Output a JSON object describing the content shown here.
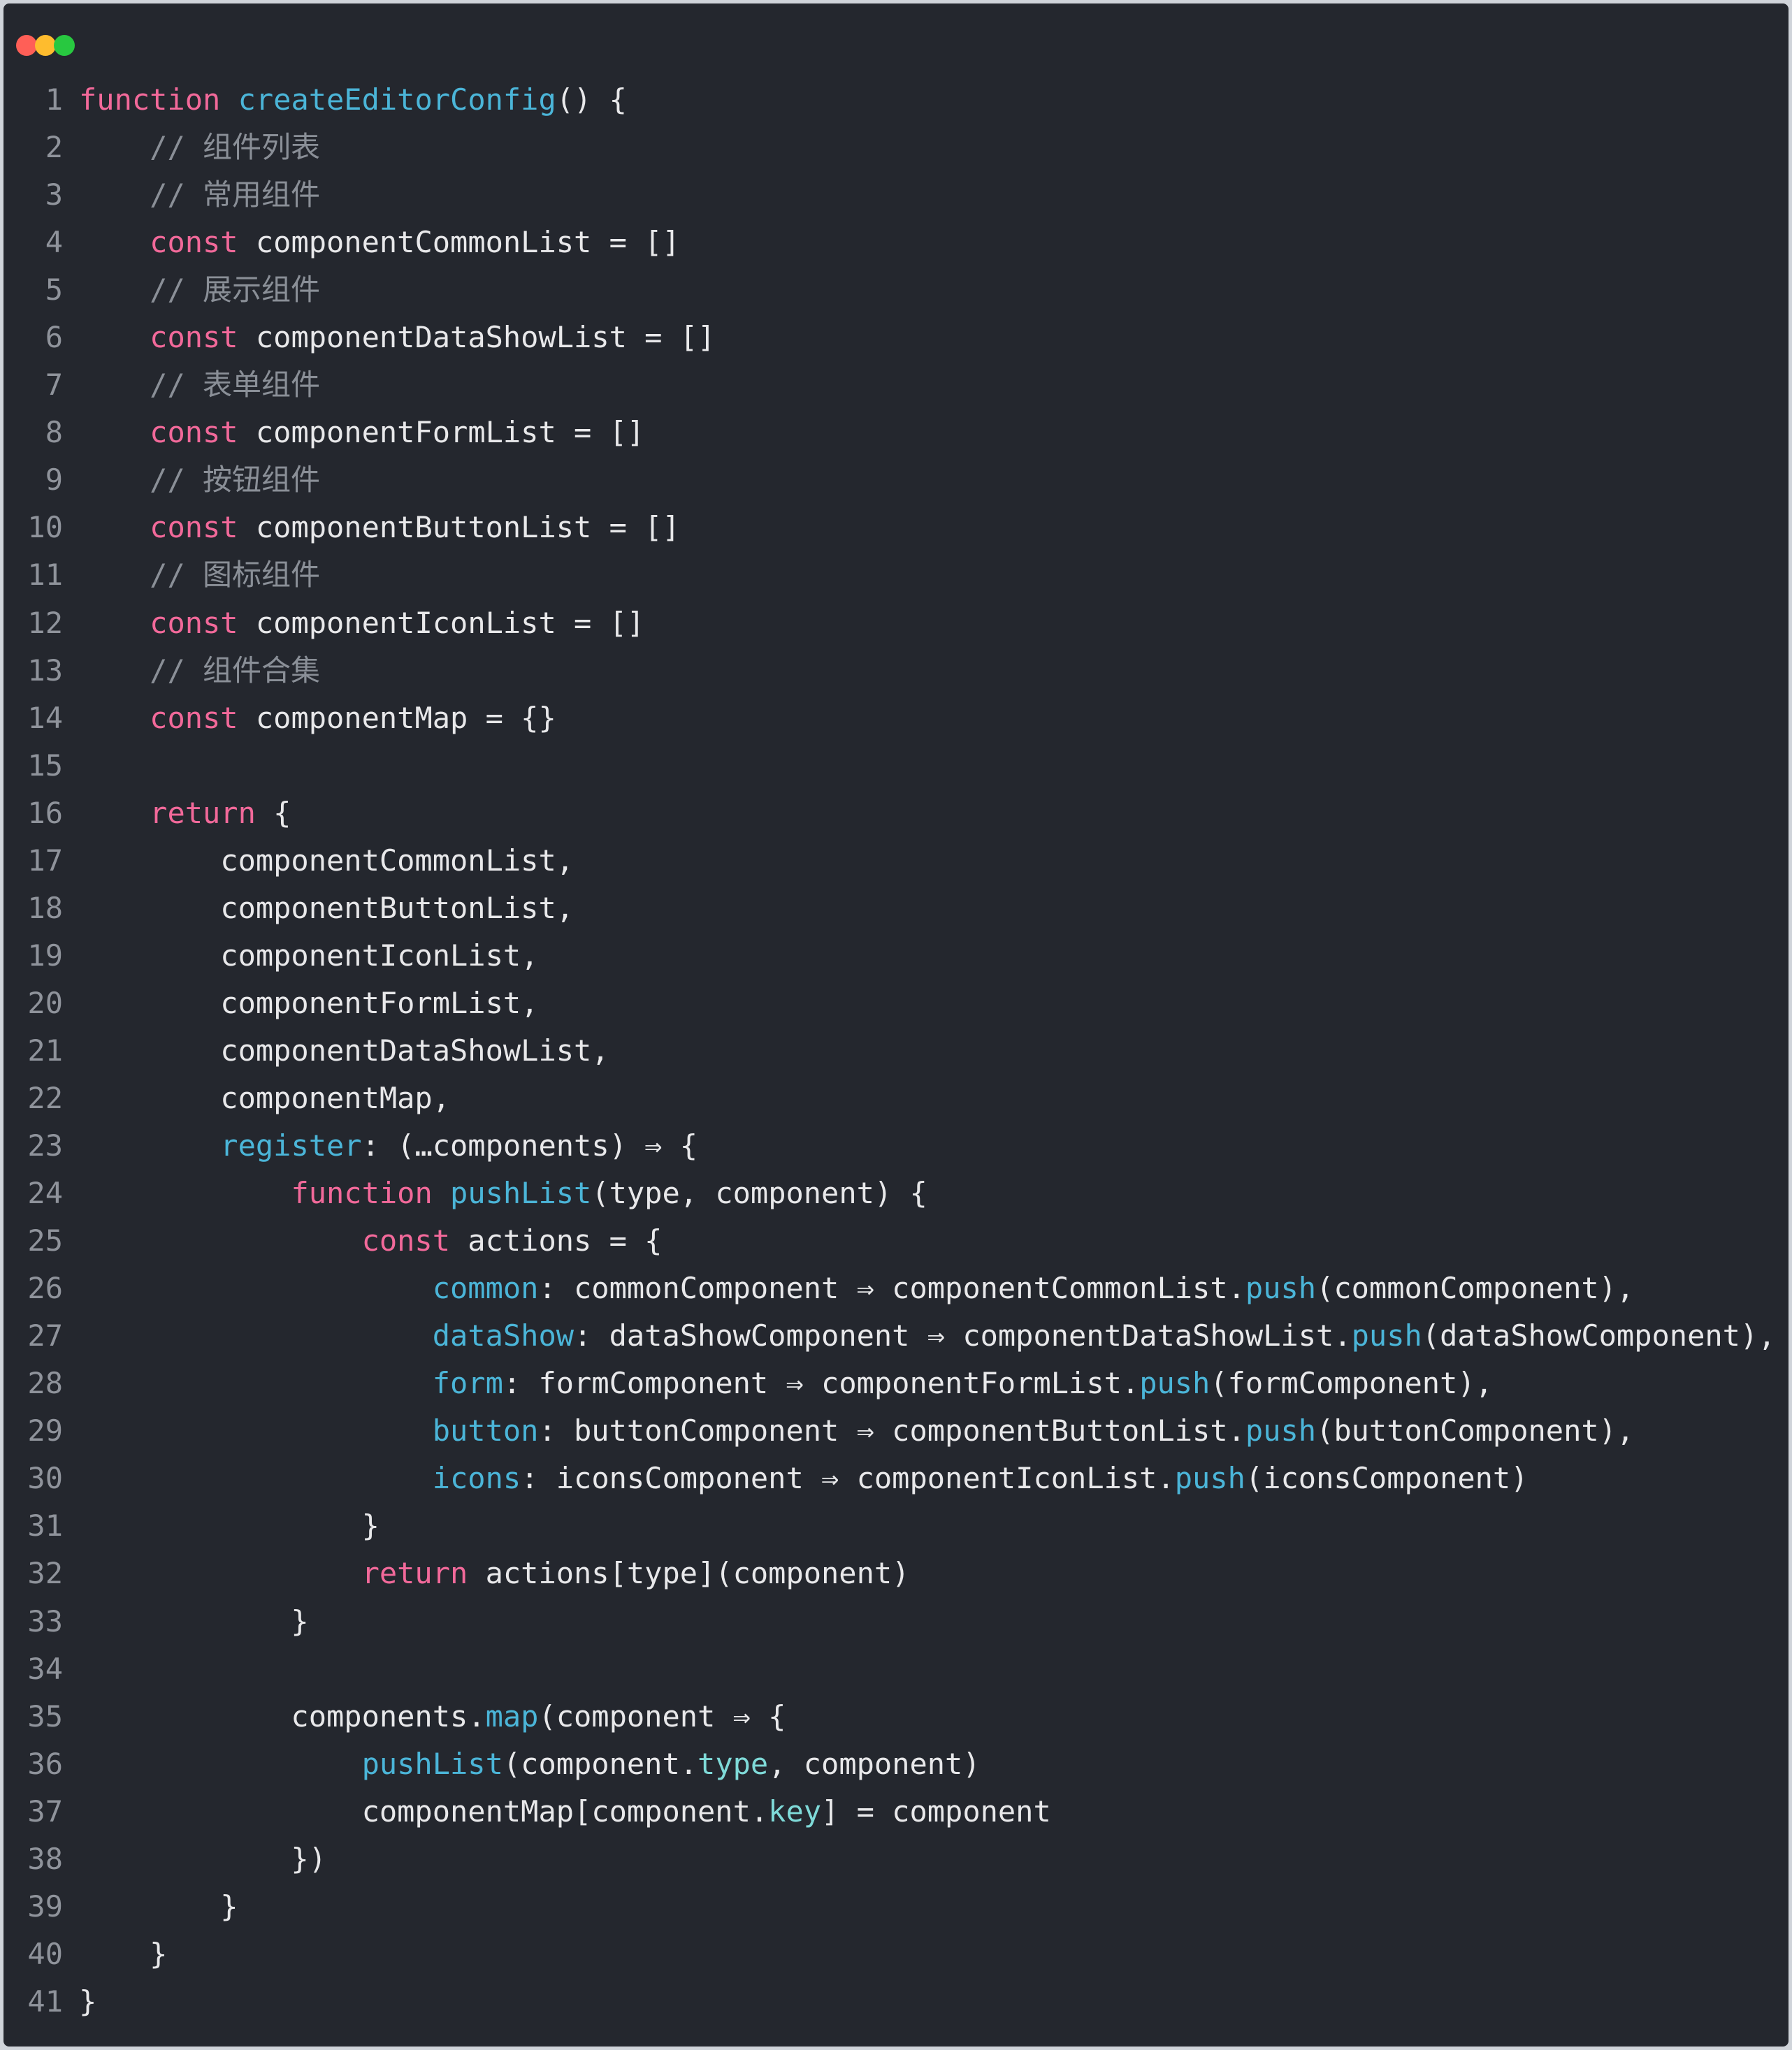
{
  "window": {
    "traffic_lights": [
      {
        "name": "close",
        "color": "#ff5f57"
      },
      {
        "name": "minimize",
        "color": "#febc2e"
      },
      {
        "name": "zoom",
        "color": "#28c840"
      }
    ]
  },
  "colors": {
    "background": "#24272e",
    "keyword": "#f2699a",
    "function": "#4bb5d8",
    "comment": "#8a8f97",
    "text": "#e8e8ea",
    "line_number": "#8f939b"
  },
  "code": {
    "language": "javascript",
    "lines": [
      {
        "n": "1",
        "tokens": [
          {
            "t": "k",
            "v": "function"
          },
          {
            "t": "p",
            "v": " "
          },
          {
            "t": "fn",
            "v": "createEditorConfig"
          },
          {
            "t": "p",
            "v": "() {"
          }
        ]
      },
      {
        "n": "2",
        "tokens": [
          {
            "t": "p",
            "v": "    "
          },
          {
            "t": "c",
            "v": "// 组件列表"
          }
        ]
      },
      {
        "n": "3",
        "tokens": [
          {
            "t": "p",
            "v": "    "
          },
          {
            "t": "c",
            "v": "// 常用组件"
          }
        ]
      },
      {
        "n": "4",
        "tokens": [
          {
            "t": "p",
            "v": "    "
          },
          {
            "t": "k",
            "v": "const"
          },
          {
            "t": "p",
            "v": " componentCommonList = []"
          }
        ]
      },
      {
        "n": "5",
        "tokens": [
          {
            "t": "p",
            "v": "    "
          },
          {
            "t": "c",
            "v": "// 展示组件"
          }
        ]
      },
      {
        "n": "6",
        "tokens": [
          {
            "t": "p",
            "v": "    "
          },
          {
            "t": "k",
            "v": "const"
          },
          {
            "t": "p",
            "v": " componentDataShowList = []"
          }
        ]
      },
      {
        "n": "7",
        "tokens": [
          {
            "t": "p",
            "v": "    "
          },
          {
            "t": "c",
            "v": "// 表单组件"
          }
        ]
      },
      {
        "n": "8",
        "tokens": [
          {
            "t": "p",
            "v": "    "
          },
          {
            "t": "k",
            "v": "const"
          },
          {
            "t": "p",
            "v": " componentFormList = []"
          }
        ]
      },
      {
        "n": "9",
        "tokens": [
          {
            "t": "p",
            "v": "    "
          },
          {
            "t": "c",
            "v": "// 按钮组件"
          }
        ]
      },
      {
        "n": "10",
        "tokens": [
          {
            "t": "p",
            "v": "    "
          },
          {
            "t": "k",
            "v": "const"
          },
          {
            "t": "p",
            "v": " componentButtonList = []"
          }
        ]
      },
      {
        "n": "11",
        "tokens": [
          {
            "t": "p",
            "v": "    "
          },
          {
            "t": "c",
            "v": "// 图标组件"
          }
        ]
      },
      {
        "n": "12",
        "tokens": [
          {
            "t": "p",
            "v": "    "
          },
          {
            "t": "k",
            "v": "const"
          },
          {
            "t": "p",
            "v": " componentIconList = []"
          }
        ]
      },
      {
        "n": "13",
        "tokens": [
          {
            "t": "p",
            "v": "    "
          },
          {
            "t": "c",
            "v": "// 组件合集"
          }
        ]
      },
      {
        "n": "14",
        "tokens": [
          {
            "t": "p",
            "v": "    "
          },
          {
            "t": "k",
            "v": "const"
          },
          {
            "t": "p",
            "v": " componentMap = {}"
          }
        ]
      },
      {
        "n": "15",
        "tokens": []
      },
      {
        "n": "16",
        "tokens": [
          {
            "t": "p",
            "v": "    "
          },
          {
            "t": "k",
            "v": "return"
          },
          {
            "t": "p",
            "v": " {"
          }
        ]
      },
      {
        "n": "17",
        "tokens": [
          {
            "t": "p",
            "v": "        componentCommonList,"
          }
        ]
      },
      {
        "n": "18",
        "tokens": [
          {
            "t": "p",
            "v": "        componentButtonList,"
          }
        ]
      },
      {
        "n": "19",
        "tokens": [
          {
            "t": "p",
            "v": "        componentIconList,"
          }
        ]
      },
      {
        "n": "20",
        "tokens": [
          {
            "t": "p",
            "v": "        componentFormList,"
          }
        ]
      },
      {
        "n": "21",
        "tokens": [
          {
            "t": "p",
            "v": "        componentDataShowList,"
          }
        ]
      },
      {
        "n": "22",
        "tokens": [
          {
            "t": "p",
            "v": "        componentMap,"
          }
        ]
      },
      {
        "n": "23",
        "tokens": [
          {
            "t": "p",
            "v": "        "
          },
          {
            "t": "prop",
            "v": "register"
          },
          {
            "t": "p",
            "v": ": (…components) ⇒ {"
          }
        ]
      },
      {
        "n": "24",
        "tokens": [
          {
            "t": "p",
            "v": "            "
          },
          {
            "t": "k",
            "v": "function"
          },
          {
            "t": "p",
            "v": " "
          },
          {
            "t": "fn",
            "v": "pushList"
          },
          {
            "t": "p",
            "v": "(type, component) {"
          }
        ]
      },
      {
        "n": "25",
        "tokens": [
          {
            "t": "p",
            "v": "                "
          },
          {
            "t": "k",
            "v": "const"
          },
          {
            "t": "p",
            "v": " actions = {"
          }
        ]
      },
      {
        "n": "26",
        "tokens": [
          {
            "t": "p",
            "v": "                    "
          },
          {
            "t": "prop",
            "v": "common"
          },
          {
            "t": "p",
            "v": ": commonComponent ⇒ componentCommonList."
          },
          {
            "t": "m",
            "v": "push"
          },
          {
            "t": "p",
            "v": "(commonComponent),"
          }
        ]
      },
      {
        "n": "27",
        "tokens": [
          {
            "t": "p",
            "v": "                    "
          },
          {
            "t": "prop",
            "v": "dataShow"
          },
          {
            "t": "p",
            "v": ": dataShowComponent ⇒ componentDataShowList."
          },
          {
            "t": "m",
            "v": "push"
          },
          {
            "t": "p",
            "v": "(dataShowComponent),"
          }
        ]
      },
      {
        "n": "28",
        "tokens": [
          {
            "t": "p",
            "v": "                    "
          },
          {
            "t": "prop",
            "v": "form"
          },
          {
            "t": "p",
            "v": ": formComponent ⇒ componentFormList."
          },
          {
            "t": "m",
            "v": "push"
          },
          {
            "t": "p",
            "v": "(formComponent),"
          }
        ]
      },
      {
        "n": "29",
        "tokens": [
          {
            "t": "p",
            "v": "                    "
          },
          {
            "t": "prop",
            "v": "button"
          },
          {
            "t": "p",
            "v": ": buttonComponent ⇒ componentButtonList."
          },
          {
            "t": "m",
            "v": "push"
          },
          {
            "t": "p",
            "v": "(buttonComponent),"
          }
        ]
      },
      {
        "n": "30",
        "tokens": [
          {
            "t": "p",
            "v": "                    "
          },
          {
            "t": "prop",
            "v": "icons"
          },
          {
            "t": "p",
            "v": ": iconsComponent ⇒ componentIconList."
          },
          {
            "t": "m",
            "v": "push"
          },
          {
            "t": "p",
            "v": "(iconsComponent)"
          }
        ]
      },
      {
        "n": "31",
        "tokens": [
          {
            "t": "p",
            "v": "                }"
          }
        ]
      },
      {
        "n": "32",
        "tokens": [
          {
            "t": "p",
            "v": "                "
          },
          {
            "t": "k",
            "v": "return"
          },
          {
            "t": "p",
            "v": " actions[type](component)"
          }
        ]
      },
      {
        "n": "33",
        "tokens": [
          {
            "t": "p",
            "v": "            }"
          }
        ]
      },
      {
        "n": "34",
        "tokens": []
      },
      {
        "n": "35",
        "tokens": [
          {
            "t": "p",
            "v": "            components."
          },
          {
            "t": "m",
            "v": "map"
          },
          {
            "t": "p",
            "v": "(component ⇒ {"
          }
        ]
      },
      {
        "n": "36",
        "tokens": [
          {
            "t": "p",
            "v": "                "
          },
          {
            "t": "fn",
            "v": "pushList"
          },
          {
            "t": "p",
            "v": "(component."
          },
          {
            "t": "f",
            "v": "type"
          },
          {
            "t": "p",
            "v": ", component)"
          }
        ]
      },
      {
        "n": "37",
        "tokens": [
          {
            "t": "p",
            "v": "                componentMap[component."
          },
          {
            "t": "f",
            "v": "key"
          },
          {
            "t": "p",
            "v": "] = component"
          }
        ]
      },
      {
        "n": "38",
        "tokens": [
          {
            "t": "p",
            "v": "            })"
          }
        ]
      },
      {
        "n": "39",
        "tokens": [
          {
            "t": "p",
            "v": "        }"
          }
        ]
      },
      {
        "n": "40",
        "tokens": [
          {
            "t": "p",
            "v": "    }"
          }
        ]
      },
      {
        "n": "41",
        "tokens": [
          {
            "t": "p",
            "v": "}"
          }
        ]
      }
    ]
  }
}
